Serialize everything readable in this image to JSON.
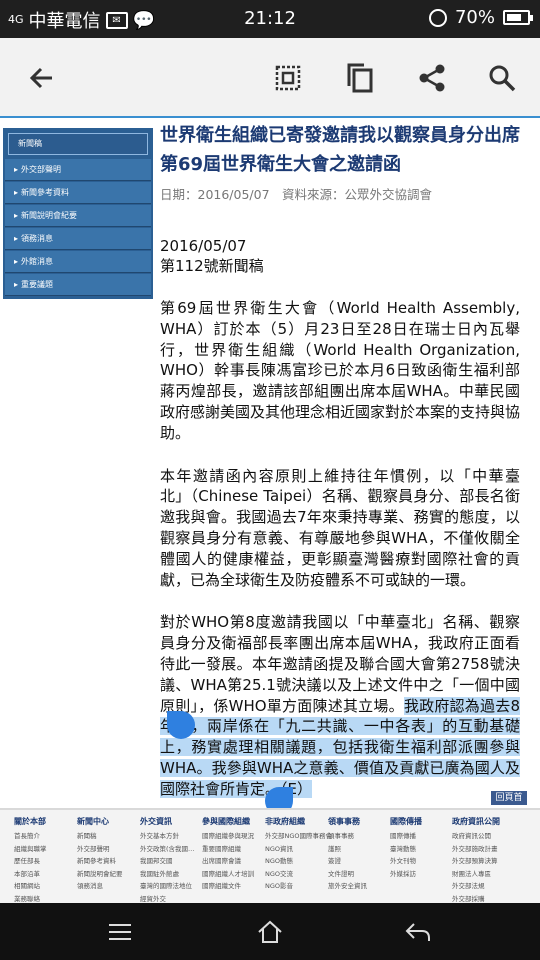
{
  "status_bar": {
    "carrier": "中華電信",
    "signal": "4G",
    "time": "21:12",
    "battery": "70%",
    "icons": [
      "signal-icon",
      "mail-icon",
      "wechat-icon",
      "alarm-icon",
      "battery-icon"
    ]
  },
  "toolbar": {
    "icons": [
      "back-arrow-icon",
      "select-all-icon",
      "copy-icon",
      "share-icon",
      "search-icon"
    ]
  },
  "sidebar": {
    "items": [
      {
        "label": "新聞稿"
      },
      {
        "label": "外交部聲明"
      },
      {
        "label": "新聞參考資料"
      },
      {
        "label": "新聞說明會紀要"
      },
      {
        "label": "領務消息"
      },
      {
        "label": "外館消息"
      },
      {
        "label": "重要議題"
      }
    ]
  },
  "article": {
    "title": "世界衛生組織已寄發邀請我以觀察員身分出席第69屆世界衛生大會之邀請函",
    "meta": "日期：2016/05/07　資料來源：公眾外交協調會",
    "date": "2016/05/07",
    "number": "第112號新聞稿",
    "para1": "第69屆世界衛生大會（World Health Assembly, WHA）訂於本（5）月23日至28日在瑞士日內瓦舉行，世界衛生組織（World Health Organization, WHO）幹事長陳馮富珍已於本月6日致函衛生福利部蔣丙煌部長，邀請該部組團出席本屆WHA。中華民國政府感謝美國及其他理念相近國家對於本案的支持與協助。",
    "para2": "本年邀請函內容原則上維持往年慣例，以「中華臺北」（Chinese Taipei）名稱、觀察員身分、部長名銜邀我與會。我國過去7年來秉持專業、務實的態度，以觀察員身分有意義、有尊嚴地參與WHA，不僅攸關全體國人的健康權益，更彰顯臺灣醫療對國際社會的貢獻，已為全球衛生及防疫體系不可或缺的一環。",
    "para3_plain": "對於WHO第8度邀請我國以「中華臺北」名稱、觀察員身分及衛福部長率團出席本屆WHA，我政府正面看待此一發展。本年邀請函提及聯合國大會第2758號決議、WHA第25.1號決議以及上述文件中之「一個中國原則」，係WHO單方面陳述其立場。",
    "para3_highlight": "我政府認為過去8年來，兩岸係在「九二共識、一中各表」的互動基礎上，務實處理相關議題，包括我衛生福利部派團參與WHA。我參與WHA之意義、價值及貢獻已廣為國人及國際社會所肯定。（E）",
    "top_button": "回頁首"
  },
  "footer": {
    "columns": [
      {
        "head": "關於本部",
        "items": [
          "首長簡介",
          "組織與職掌",
          "歷任部長",
          "本部沿革",
          "相關網站",
          "業務聯絡"
        ]
      },
      {
        "head": "新聞中心",
        "items": [
          "新聞稿",
          "外交部聲明",
          "新聞參考資料",
          "新聞說明會紀要",
          "領務消息"
        ]
      },
      {
        "head": "外交資訊",
        "items": [
          "外交基本方針",
          "外交政策(含我國…",
          "我國邦交國",
          "我國駐外館處",
          "臺灣的國際法地位",
          "經貿外交"
        ]
      },
      {
        "head": "參與國際組織",
        "items": [
          "國際組織參與現況",
          "重要國際組織",
          "出席國際會議",
          "國際組織人才培訓",
          "國際組織文件"
        ]
      },
      {
        "head": "非政府組織",
        "items": [
          "外交部NGO國際事務會",
          "NGO資訊",
          "NGO動態",
          "NGO交流",
          "NGO影音"
        ]
      },
      {
        "head": "領事事務",
        "items": [
          "領事事務",
          "護照",
          "簽證",
          "文件證明",
          "旅外安全資訊"
        ]
      },
      {
        "head": "國際傳播",
        "items": [
          "國際傳播",
          "臺灣動態",
          "外文刊物",
          "外媒採訪"
        ]
      },
      {
        "head": "政府資訊公開",
        "items": [
          "政府資訊公開",
          "外交部施政計畫",
          "外交部預算決算",
          "財團法人專區",
          "外交部法規",
          "外交部採購"
        ]
      }
    ]
  },
  "nav_bar": {
    "icons": [
      "menu-icon",
      "home-icon",
      "back-icon"
    ]
  },
  "colors": {
    "title_blue": "#1c3a73",
    "sidebar_blue": "#2b5f93",
    "selection": "#b9d9f5",
    "handle": "#2f80e0"
  }
}
